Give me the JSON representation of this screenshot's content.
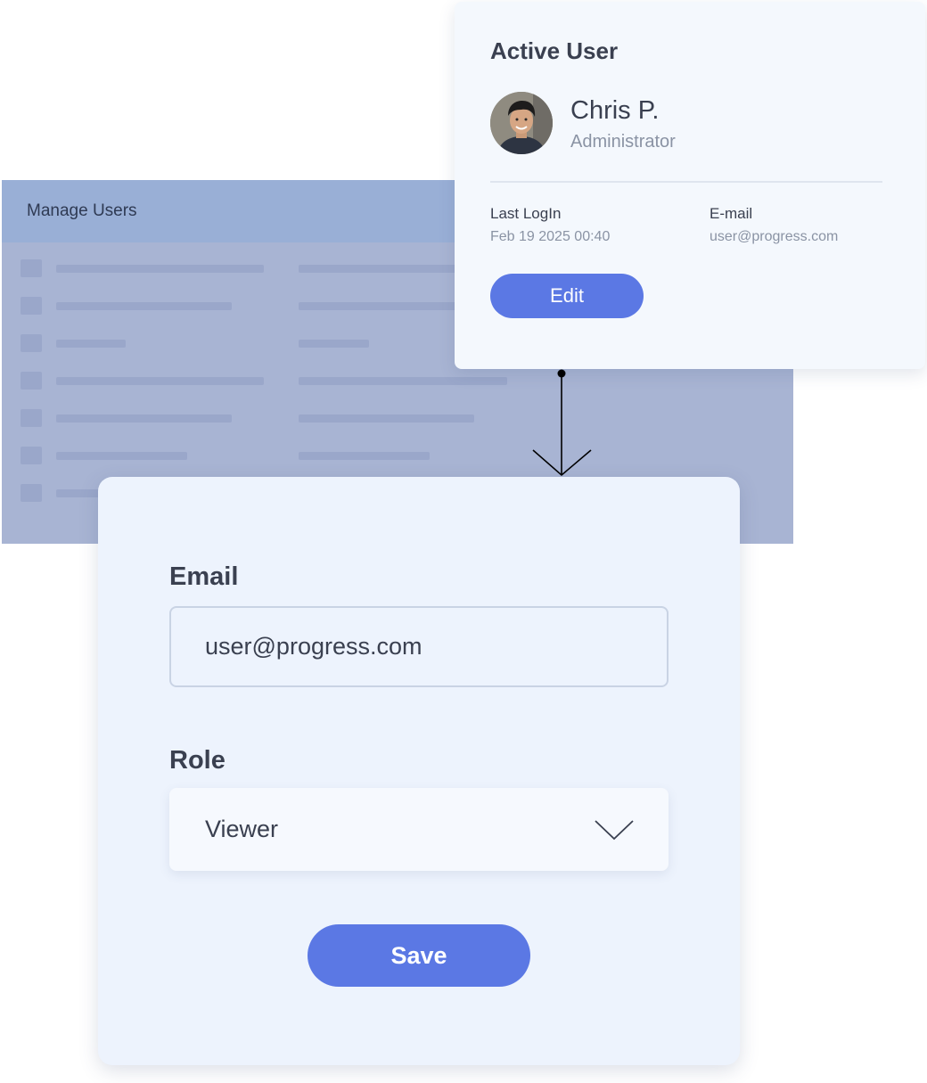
{
  "manage_users": {
    "title": "Manage Users"
  },
  "active_user_card": {
    "title": "Active User",
    "user": {
      "name": "Chris P.",
      "role": "Administrator"
    },
    "last_login": {
      "label": "Last LogIn",
      "value": "Feb 19 2025 00:40"
    },
    "email": {
      "label": "E-mail",
      "value": "user@progress.com"
    },
    "edit_label": "Edit"
  },
  "edit_form": {
    "email_label": "Email",
    "email_value": "user@progress.com",
    "role_label": "Role",
    "role_value": "Viewer",
    "save_label": "Save"
  },
  "colors": {
    "accent": "#5b78e4",
    "panel_bg": "#a8b4d3",
    "panel_header": "#99afd6",
    "card_bg": "#f4f8fd",
    "form_bg": "#edf3fd",
    "text_dark": "#3a4050",
    "text_muted": "#8a93a4"
  },
  "icons": {
    "avatar": "user-photo",
    "connector": "arrow-down-icon",
    "role_dropdown": "chevron-down-icon"
  }
}
